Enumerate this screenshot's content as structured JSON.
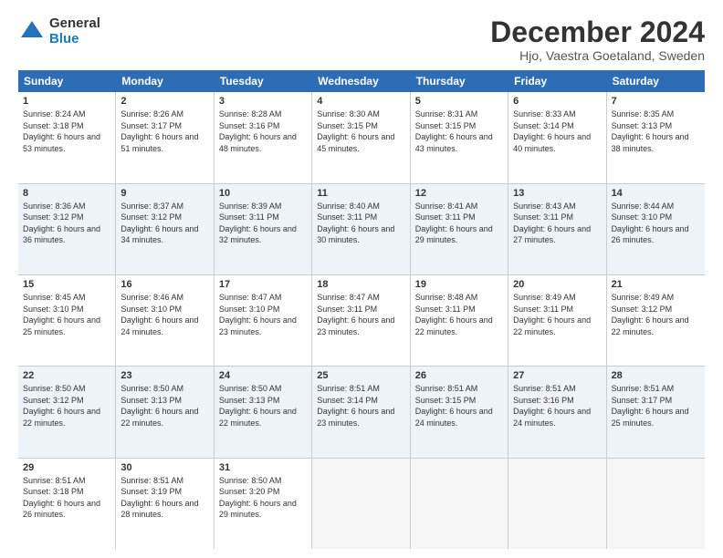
{
  "logo": {
    "general": "General",
    "blue": "Blue"
  },
  "header": {
    "title": "December 2024",
    "subtitle": "Hjo, Vaestra Goetaland, Sweden"
  },
  "weekdays": [
    "Sunday",
    "Monday",
    "Tuesday",
    "Wednesday",
    "Thursday",
    "Friday",
    "Saturday"
  ],
  "weeks": [
    {
      "alt": false,
      "days": [
        {
          "num": "1",
          "sunrise": "Sunrise: 8:24 AM",
          "sunset": "Sunset: 3:18 PM",
          "daylight": "Daylight: 6 hours and 53 minutes."
        },
        {
          "num": "2",
          "sunrise": "Sunrise: 8:26 AM",
          "sunset": "Sunset: 3:17 PM",
          "daylight": "Daylight: 6 hours and 51 minutes."
        },
        {
          "num": "3",
          "sunrise": "Sunrise: 8:28 AM",
          "sunset": "Sunset: 3:16 PM",
          "daylight": "Daylight: 6 hours and 48 minutes."
        },
        {
          "num": "4",
          "sunrise": "Sunrise: 8:30 AM",
          "sunset": "Sunset: 3:15 PM",
          "daylight": "Daylight: 6 hours and 45 minutes."
        },
        {
          "num": "5",
          "sunrise": "Sunrise: 8:31 AM",
          "sunset": "Sunset: 3:15 PM",
          "daylight": "Daylight: 6 hours and 43 minutes."
        },
        {
          "num": "6",
          "sunrise": "Sunrise: 8:33 AM",
          "sunset": "Sunset: 3:14 PM",
          "daylight": "Daylight: 6 hours and 40 minutes."
        },
        {
          "num": "7",
          "sunrise": "Sunrise: 8:35 AM",
          "sunset": "Sunset: 3:13 PM",
          "daylight": "Daylight: 6 hours and 38 minutes."
        }
      ]
    },
    {
      "alt": true,
      "days": [
        {
          "num": "8",
          "sunrise": "Sunrise: 8:36 AM",
          "sunset": "Sunset: 3:12 PM",
          "daylight": "Daylight: 6 hours and 36 minutes."
        },
        {
          "num": "9",
          "sunrise": "Sunrise: 8:37 AM",
          "sunset": "Sunset: 3:12 PM",
          "daylight": "Daylight: 6 hours and 34 minutes."
        },
        {
          "num": "10",
          "sunrise": "Sunrise: 8:39 AM",
          "sunset": "Sunset: 3:11 PM",
          "daylight": "Daylight: 6 hours and 32 minutes."
        },
        {
          "num": "11",
          "sunrise": "Sunrise: 8:40 AM",
          "sunset": "Sunset: 3:11 PM",
          "daylight": "Daylight: 6 hours and 30 minutes."
        },
        {
          "num": "12",
          "sunrise": "Sunrise: 8:41 AM",
          "sunset": "Sunset: 3:11 PM",
          "daylight": "Daylight: 6 hours and 29 minutes."
        },
        {
          "num": "13",
          "sunrise": "Sunrise: 8:43 AM",
          "sunset": "Sunset: 3:11 PM",
          "daylight": "Daylight: 6 hours and 27 minutes."
        },
        {
          "num": "14",
          "sunrise": "Sunrise: 8:44 AM",
          "sunset": "Sunset: 3:10 PM",
          "daylight": "Daylight: 6 hours and 26 minutes."
        }
      ]
    },
    {
      "alt": false,
      "days": [
        {
          "num": "15",
          "sunrise": "Sunrise: 8:45 AM",
          "sunset": "Sunset: 3:10 PM",
          "daylight": "Daylight: 6 hours and 25 minutes."
        },
        {
          "num": "16",
          "sunrise": "Sunrise: 8:46 AM",
          "sunset": "Sunset: 3:10 PM",
          "daylight": "Daylight: 6 hours and 24 minutes."
        },
        {
          "num": "17",
          "sunrise": "Sunrise: 8:47 AM",
          "sunset": "Sunset: 3:10 PM",
          "daylight": "Daylight: 6 hours and 23 minutes."
        },
        {
          "num": "18",
          "sunrise": "Sunrise: 8:47 AM",
          "sunset": "Sunset: 3:11 PM",
          "daylight": "Daylight: 6 hours and 23 minutes."
        },
        {
          "num": "19",
          "sunrise": "Sunrise: 8:48 AM",
          "sunset": "Sunset: 3:11 PM",
          "daylight": "Daylight: 6 hours and 22 minutes."
        },
        {
          "num": "20",
          "sunrise": "Sunrise: 8:49 AM",
          "sunset": "Sunset: 3:11 PM",
          "daylight": "Daylight: 6 hours and 22 minutes."
        },
        {
          "num": "21",
          "sunrise": "Sunrise: 8:49 AM",
          "sunset": "Sunset: 3:12 PM",
          "daylight": "Daylight: 6 hours and 22 minutes."
        }
      ]
    },
    {
      "alt": true,
      "days": [
        {
          "num": "22",
          "sunrise": "Sunrise: 8:50 AM",
          "sunset": "Sunset: 3:12 PM",
          "daylight": "Daylight: 6 hours and 22 minutes."
        },
        {
          "num": "23",
          "sunrise": "Sunrise: 8:50 AM",
          "sunset": "Sunset: 3:13 PM",
          "daylight": "Daylight: 6 hours and 22 minutes."
        },
        {
          "num": "24",
          "sunrise": "Sunrise: 8:50 AM",
          "sunset": "Sunset: 3:13 PM",
          "daylight": "Daylight: 6 hours and 22 minutes."
        },
        {
          "num": "25",
          "sunrise": "Sunrise: 8:51 AM",
          "sunset": "Sunset: 3:14 PM",
          "daylight": "Daylight: 6 hours and 23 minutes."
        },
        {
          "num": "26",
          "sunrise": "Sunrise: 8:51 AM",
          "sunset": "Sunset: 3:15 PM",
          "daylight": "Daylight: 6 hours and 24 minutes."
        },
        {
          "num": "27",
          "sunrise": "Sunrise: 8:51 AM",
          "sunset": "Sunset: 3:16 PM",
          "daylight": "Daylight: 6 hours and 24 minutes."
        },
        {
          "num": "28",
          "sunrise": "Sunrise: 8:51 AM",
          "sunset": "Sunset: 3:17 PM",
          "daylight": "Daylight: 6 hours and 25 minutes."
        }
      ]
    },
    {
      "alt": false,
      "days": [
        {
          "num": "29",
          "sunrise": "Sunrise: 8:51 AM",
          "sunset": "Sunset: 3:18 PM",
          "daylight": "Daylight: 6 hours and 26 minutes."
        },
        {
          "num": "30",
          "sunrise": "Sunrise: 8:51 AM",
          "sunset": "Sunset: 3:19 PM",
          "daylight": "Daylight: 6 hours and 28 minutes."
        },
        {
          "num": "31",
          "sunrise": "Sunrise: 8:50 AM",
          "sunset": "Sunset: 3:20 PM",
          "daylight": "Daylight: 6 hours and 29 minutes."
        },
        null,
        null,
        null,
        null
      ]
    }
  ]
}
